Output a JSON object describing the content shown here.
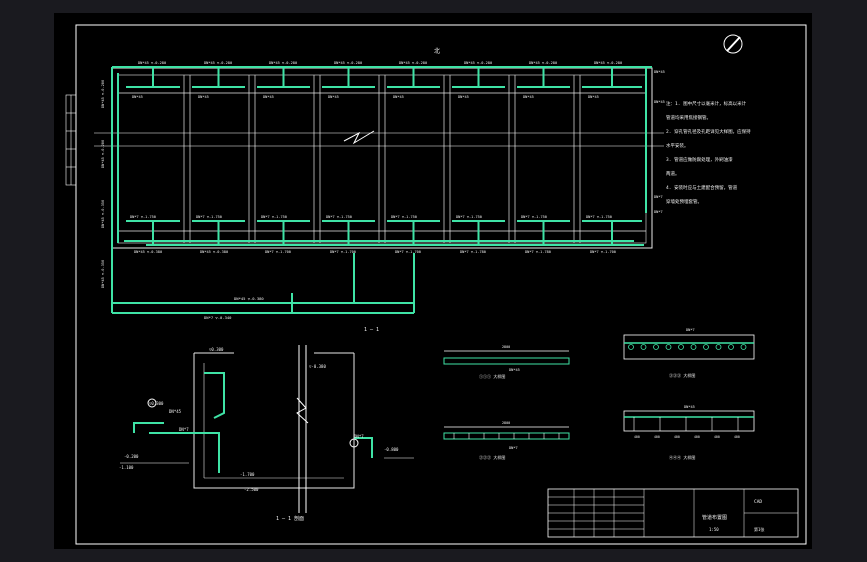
{
  "drawing": {
    "pipe_labels_top": [
      "DN*45 ▽-0.280",
      "DN*45 ▽-0.280",
      "DN*45 ▽-0.280",
      "DN*45 ▽-0.280",
      "DN*45 ▽-0.280",
      "DN*45 ▽-0.280",
      "DN*45 ▽-0.280",
      "DN*45 ▽-0.280"
    ],
    "riser_label": "DN*45",
    "bottom_label_row": [
      "DN*7 ▽-1.750",
      "DN*7 ▽-1.750",
      "DN*7 ▽-1.750",
      "DN*7 ▽-1.750",
      "DN*7 ▽-1.750",
      "DN*7 ▽-1.750",
      "DN*7 ▽-1.750",
      "DN*7 ▽-1.750"
    ],
    "main_pipe_labels": [
      "DN*45 ▽-0.380",
      "DN*45 ▽-0.380",
      "DN*7 ▽-1.700",
      "DN*7 ▽-1.700",
      "DN*7 ▽-1.700",
      "DN*7 ▽-1.780",
      "DN*7 ▽-1.780",
      "DN*7 ▽-1.700"
    ],
    "header_main_labels": [
      "DN*45 ▽-0.380",
      "DN*7 ▽-0.340"
    ],
    "left_vertical_labels": [
      "DN*45 ▽-0.280",
      "DN*45 ▽-0.280",
      "DN*45 ▽-0.350",
      "DN*45 ▽-0.350"
    ],
    "right_side_labels": [
      "DN*45",
      "DN*45",
      "DN*7",
      "DN*7"
    ],
    "north_label": "北",
    "plan_title": "1 ─ 1",
    "notes": [
      "注：1. 图中尺寸以毫米计，标高以米计",
      "管道均采用焦接钢管。",
      "2. 穿孔管孔径及孔距详见大样图，应保持",
      "水平安装。",
      "3. 管道应做防腐处理，外刷油漆",
      "两道。",
      "4. 安装时应与土建配合预留，管道",
      "穿墙处预埋套管。"
    ],
    "detail_titles": [
      "①①① 大样图",
      "②②② 大样图",
      "③③③ 大样图",
      "④④④ 大样图"
    ],
    "detail_labels": [
      "DN*45",
      "DN*7",
      "DN*7",
      "DN*45"
    ],
    "detail_dims": [
      "2800",
      "2800",
      "400",
      "400",
      "400",
      "400",
      "400",
      "400"
    ],
    "section_labels": [
      "▽0.300",
      "-0.200",
      "-1.100",
      "-1.700",
      "-2.500",
      "▽-0.380",
      "-0.800",
      "▽0.300"
    ],
    "section_pipes": [
      "DN*45",
      "DN*7",
      "DN*7"
    ],
    "section_title": "1 ─ 1 剖面",
    "title_block": {
      "drawing_name": "管道布置图",
      "code": "CAD",
      "sheet": "第1张",
      "scale": "1:50"
    }
  }
}
